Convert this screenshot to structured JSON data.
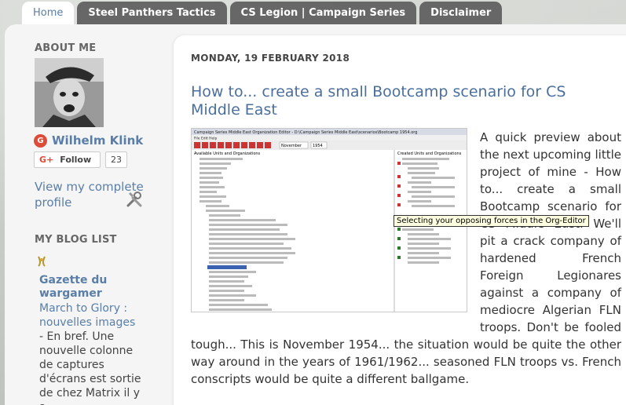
{
  "tabs": [
    {
      "label": "Home",
      "active": true
    },
    {
      "label": "Steel Panthers Tactics",
      "active": false
    },
    {
      "label": "CS Legion | Campaign Series",
      "active": false
    },
    {
      "label": "Disclaimer",
      "active": false
    }
  ],
  "sidebar": {
    "about_heading": "ABOUT ME",
    "author_name": "Wilhelm Klink",
    "follow_label": "Follow",
    "follow_g": "G+",
    "follow_count": "23",
    "profile_link": "View my complete profile",
    "blog_list_heading": "MY BLOG LIST",
    "blog": {
      "title": "Gazette du wargamer",
      "post_title": "March to Glory : nouvelles images",
      "excerpt": "- En bref. Une nouvelle colonne de captures d'écrans est sortie de chez Matrix il y a"
    }
  },
  "post": {
    "date": "MONDAY, 19 FEBRUARY 2018",
    "title": "How to... create a small Bootcamp scenario for CS Middle East",
    "body": "A quick preview about the next upcoming little project of mine - How to... create a small Bootcamp scenario for CS Middle East. We'll pit a crack company of hardened French Foreign Legionares against a company of mediocre Algerian FLN troops. Don't be fooled tough... This is November 1954... the situation would be quite the other way around in the years of 1961/1962... seasoned FLN troops vs. French conscripts would be quite a different ballgame.",
    "tooltip": "Selecting your opposing forces in the Org-Editor",
    "screenshot": {
      "window_title": "Campaign Series Middle East Organization Editor - D:\\Campaign Series Middle East\\scenarios\\Bootcamp 1954.org",
      "menu": "File  Edit  Help",
      "month": "November",
      "year": "1954",
      "left_panel_title": "Available Units and Organizations",
      "right_panel_title": "Created Units and Organizations"
    }
  },
  "colors": {
    "link": "#5a7ea8",
    "tab_bg": "#666766",
    "gplus_red": "#dd4b39"
  }
}
